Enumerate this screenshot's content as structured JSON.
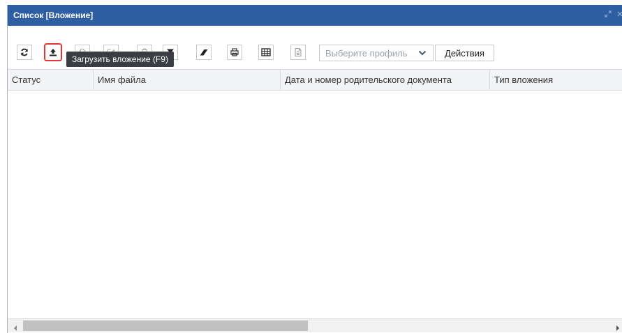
{
  "window": {
    "title": "Список [Вложение]"
  },
  "toolbar": {
    "buttons": [
      {
        "name": "refresh",
        "icon": "refresh-icon",
        "enabled": true
      },
      {
        "name": "upload",
        "icon": "upload-icon",
        "enabled": true,
        "highlighted": true
      },
      {
        "name": "copy",
        "icon": "copy-icon",
        "enabled": false
      },
      {
        "name": "edit",
        "icon": "edit-icon",
        "enabled": false
      },
      {
        "name": "delete",
        "icon": "trash-icon",
        "enabled": false
      },
      {
        "name": "filter",
        "icon": "filter-icon",
        "enabled": true
      },
      {
        "name": "clear-filter",
        "icon": "eraser-icon",
        "enabled": true
      },
      {
        "name": "print",
        "icon": "print-icon",
        "enabled": true
      },
      {
        "name": "table",
        "icon": "table-icon",
        "enabled": true
      },
      {
        "name": "document",
        "icon": "document-icon",
        "enabled": false
      }
    ],
    "profile_placeholder": "Выберите профиль",
    "actions_label": "Действия"
  },
  "tooltip": {
    "text": "Загрузить вложение (F9)"
  },
  "grid": {
    "columns": [
      "Статус",
      "Имя файла",
      "Дата и номер родительского документа",
      "Тип вложения"
    ],
    "rows": []
  },
  "colors": {
    "titlebar": "#2e5fa3",
    "highlight": "#e23434",
    "tooltip_bg": "#3a3d42"
  }
}
